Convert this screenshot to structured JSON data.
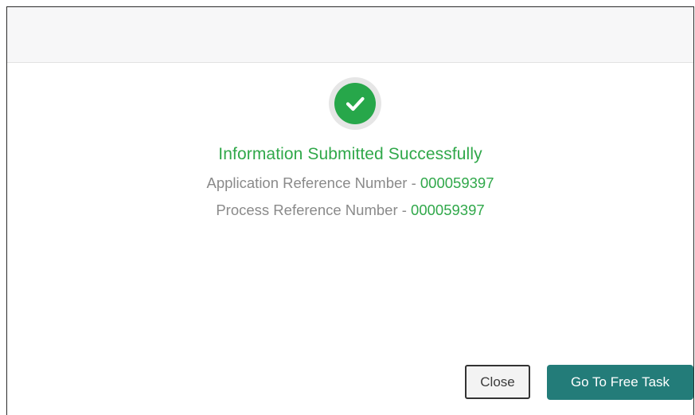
{
  "dialog": {
    "status_icon": "check-circle-icon",
    "message": "Information Submitted Successfully",
    "application_ref_label": "Application Reference Number - ",
    "application_ref_value": "000059397",
    "process_ref_label": "Process Reference Number - ",
    "process_ref_value": "000059397"
  },
  "actions": {
    "close_label": "Close",
    "free_task_label": "Go To Free Task"
  },
  "colors": {
    "success": "#30a84a",
    "primary_button": "#237c79",
    "muted_text": "#8a8a8a"
  }
}
